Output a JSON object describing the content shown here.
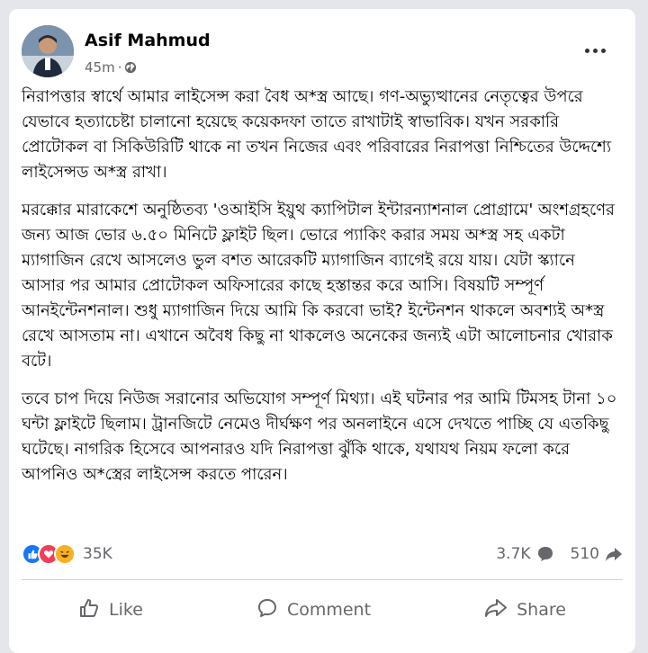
{
  "post": {
    "author": "Asif Mahmud",
    "time": "45m",
    "separator": "·",
    "paragraphs": [
      "নিরাপত্তার স্বার্থে আমার লাইসেন্স করা বৈধ অ*স্ত্র আছে। গণ-অভ্যুত্থানের নেতৃত্বের উপরে যেভাবে হত্যাচেষ্টা চালানো হয়েছে কয়েকদফা তাতে রাখাটাই স্বাভাবিক। যখন সরকারি প্রোটোকল বা সিকিউরিটি থাকে না তখন নিজের এবং পরিবারের নিরাপত্তা নিশ্চিতের উদ্দেশ্যে লাইসেন্সড অ*স্ত্র রাখা।",
      "মরক্কোর মারাকেশে অনুষ্ঠিতব্য 'ওআইসি ইয়ুথ ক্যাপিটাল ইন্টারন্যাশনাল প্রোগ্রামে' অংশগ্রহণের জন্য আজ ভোর ৬.৫০ মিনিটে ফ্লাইট ছিল। ভোরে প্যাকিং করার সময় অ*স্ত্র সহ একটা ম্যাগাজিন রেখে আসলেও ভুল বশত আরেকটি ম্যাগাজিন ব্যাগেই রয়ে যায়। যেটা স্ক্যানে আসার পর আমার প্রোটোকল অফিসারের কাছে হস্তান্তর করে আসি। বিষয়টি সম্পূর্ণ আনইন্টেনশনাল। শুধু ম্যাগাজিন দিয়ে আমি কি করবো ভাই? ইন্টেনশন থাকলে অবশ্যই অ*স্ত্র রেখে আসতাম না। এখানে অবৈধ কিছু না থাকলেও অনেকের জন্যই এটা আলোচনার খোরাক বটে।",
      "তবে চাপ দিয়ে নিউজ সরানোর অভিযোগ সম্পূর্ণ মিথ্যা। এই ঘটনার পর আমি টিমসহ টানা ১০ ঘন্টা ফ্লাইটে ছিলাম। ট্রানজিটে নেমেও দীর্ঘক্ষণ পর অনলাইনে এসে দেখতে পাচ্ছি যে এতকিছু ঘটেছে। নাগরিক হিসেবে আপনারও যদি নিরাপত্তা ঝুঁকি থাকে, যথাযথ নিয়ম ফলো করে আপনিও অ*স্ত্রের লাইসেন্স করতে পারেন।"
    ]
  },
  "stats": {
    "reactions": "35K",
    "comments": "3.7K",
    "shares": "510"
  },
  "actions": {
    "like": "Like",
    "comment": "Comment",
    "share": "Share"
  },
  "icons": {
    "like": "thumbs-up-icon",
    "comment": "speech-bubble-icon",
    "share": "share-arrow-icon",
    "privacy": "globe-icon",
    "more": "more-horizontal-icon"
  },
  "colors": {
    "like_blue": "#1877f2",
    "love_red": "#f33e58",
    "haha_yellow": "#f7b125",
    "muted_text": "#65676b"
  }
}
